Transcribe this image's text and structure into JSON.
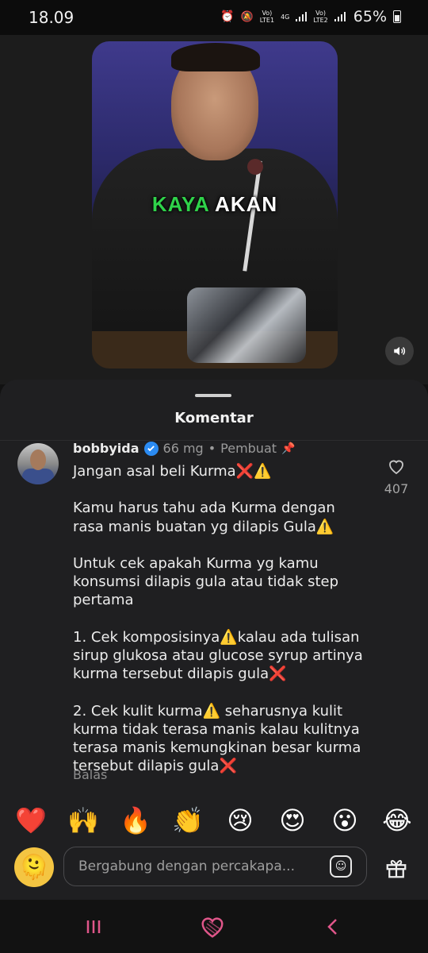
{
  "status_bar": {
    "time": "18.09",
    "sim1_label_top": "Vo)",
    "sim1_label_bottom": "LTE1",
    "net_type": "4G",
    "sim2_label_top": "Vo)",
    "sim2_label_bottom": "LTE2",
    "battery_percent": "65%"
  },
  "video": {
    "caption_word1": "KAYA",
    "caption_word2": "AKAN",
    "caption_word1_color": "#2fd24a"
  },
  "comments_sheet": {
    "title": "Komentar",
    "comment": {
      "username": "bobbyida",
      "time": "66 mg",
      "separator": "•",
      "role": "Pembuat",
      "lines": [
        "Jangan asal beli Kurma❌⚠️",
        "",
        "Kamu harus tahu ada Kurma dengan rasa manis buatan yg dilapis Gula⚠️",
        "",
        "Untuk cek apakah Kurma yg kamu konsumsi dilapis gula atau tidak step pertama",
        "",
        "1. Cek komposisinya⚠️kalau ada tulisan sirup glukosa atau glucose syrup artinya kurma tersebut dilapis gula❌",
        "",
        "2. Cek kulit kurma⚠️ seharusnya kulit kurma tidak terasa manis kalau kulitnya terasa manis kemungkinan besar kurma tersebut dilapis gula❌"
      ],
      "reply_label": "Balas",
      "like_count": "407"
    }
  },
  "quick_reactions": [
    "❤️",
    "🙌",
    "🔥",
    "👏",
    "😢",
    "😍",
    "😮",
    "😂"
  ],
  "composer": {
    "avatar_emoji": "🫠",
    "placeholder": "Bergabung dengan percakapa..."
  },
  "colors": {
    "accent_blue": "#2b8bf2",
    "nav_pink": "#e0568a"
  }
}
